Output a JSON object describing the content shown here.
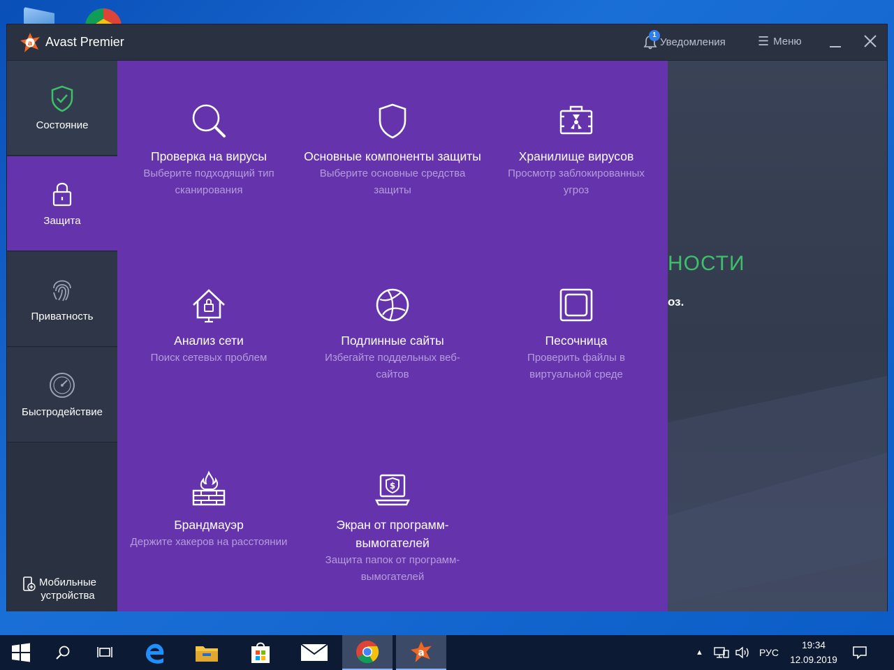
{
  "window": {
    "title": "Avast Premier"
  },
  "header": {
    "notifications_label": "Уведомления",
    "notifications_count": "1",
    "menu_label": "Меню"
  },
  "sidebar": {
    "items": [
      {
        "label": "Состояние",
        "icon": "shield-check-icon"
      },
      {
        "label": "Защита",
        "icon": "lock-icon"
      },
      {
        "label": "Приватность",
        "icon": "fingerprint-icon"
      },
      {
        "label": "Быстродействие",
        "icon": "speedometer-icon"
      }
    ],
    "mobile_line1": "Мобильные",
    "mobile_line2": "устройства"
  },
  "background": {
    "title_fragment": "НОСТИ",
    "sub_fragment": "оз."
  },
  "tiles": [
    {
      "title": "Проверка на вирусы",
      "desc": "Выберите подходящий тип сканирования",
      "icon": "magnifier-icon"
    },
    {
      "title": "Основные компоненты защиты",
      "desc": "Выберите основные средства защиты",
      "icon": "shield-icon"
    },
    {
      "title": "Хранилище вирусов",
      "desc": "Просмотр заблокированных угроз",
      "icon": "virus-chest-icon"
    },
    {
      "title": "Анализ сети",
      "desc": "Поиск сетевых проблем",
      "icon": "home-network-icon"
    },
    {
      "title": "Подлинные сайты",
      "desc": "Избегайте поддельных веб-сайтов",
      "icon": "globe-icon"
    },
    {
      "title": "Песочница",
      "desc": "Проверить файлы в виртуальной среде",
      "icon": "sandbox-icon"
    },
    {
      "title": "Брандмауэр",
      "desc": "Держите хакеров на расстоянии",
      "icon": "firewall-icon"
    },
    {
      "title": "Экран от программ-вымогателей",
      "desc": "Защита папок от программ-вымогателей",
      "icon": "ransomware-shield-icon"
    }
  ],
  "taskbar": {
    "language": "РУС",
    "time": "19:34",
    "date": "12.09.2019"
  },
  "colors": {
    "purple": "#6534ac",
    "dark": "#2d3445",
    "accent_green": "#3fbf6a",
    "avast_orange": "#f26522"
  }
}
